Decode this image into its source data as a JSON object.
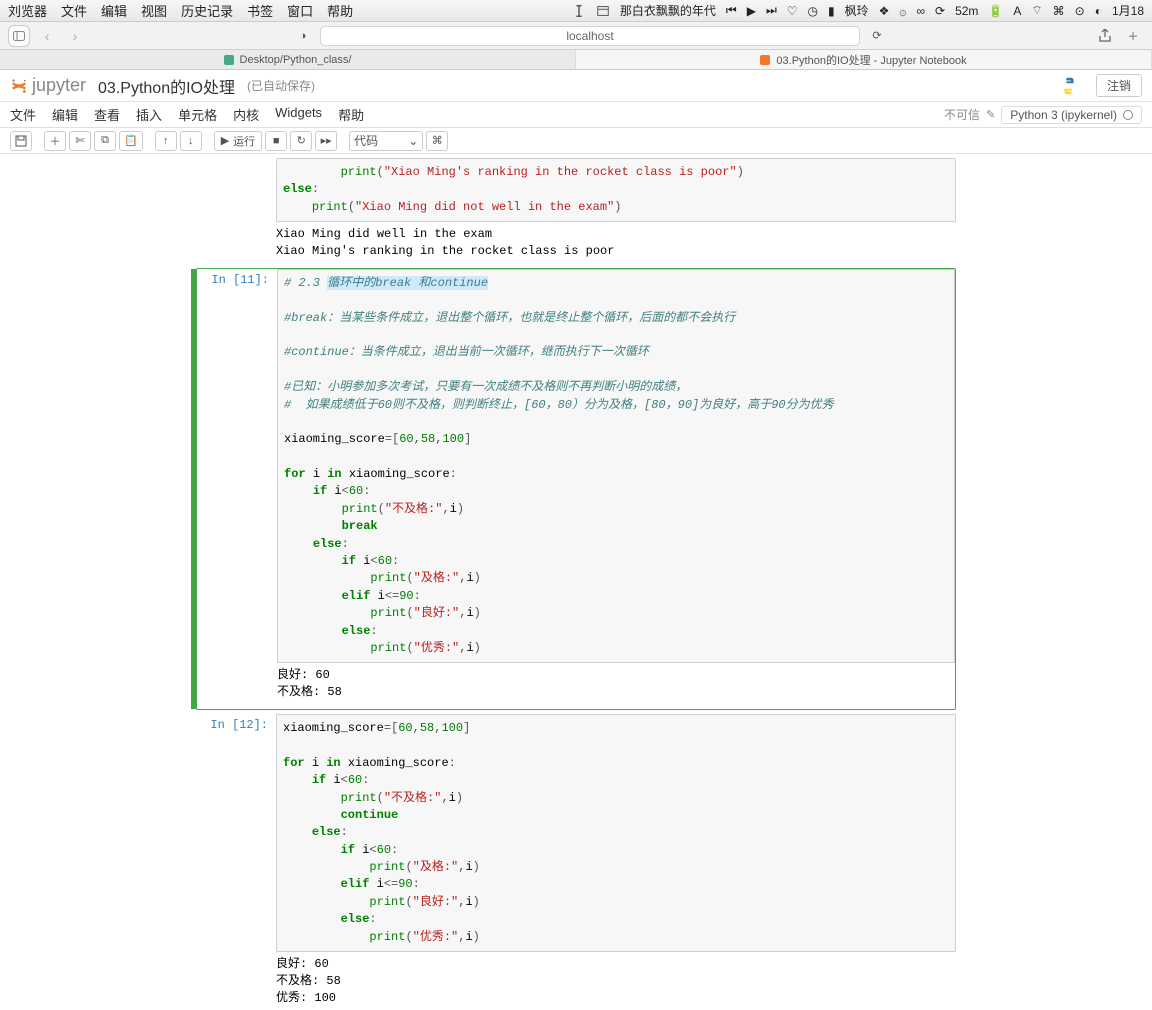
{
  "mac_menu": {
    "app": "刘览器",
    "items": [
      "文件",
      "编辑",
      "视图",
      "历史记录",
      "书签",
      "窗口",
      "帮助"
    ],
    "right": {
      "song": "那白衣飘飘的年代",
      "user": "枫玲",
      "time": "52m",
      "date": "1月18"
    }
  },
  "browser": {
    "url": "localhost",
    "tabs": [
      {
        "label": "Desktop/Python_class/",
        "active": false
      },
      {
        "label": "03.Python的IO处理 - Jupyter Notebook",
        "active": true
      }
    ]
  },
  "notebook": {
    "logo_word": "jupyter",
    "name": "03.Python的IO处理",
    "autosave": "(已自动保存)",
    "logout": "注销",
    "menus": [
      "文件",
      "编辑",
      "查看",
      "插入",
      "单元格",
      "内核",
      "Widgets",
      "帮助"
    ],
    "trusted": "不可信",
    "kernel": "Python 3 (ipykernel)",
    "toolbar": {
      "run_label": "运行",
      "celltype": "代码"
    }
  },
  "cells": {
    "top_output": "Xiao Ming did well in the exam\nXiao Ming's ranking in the rocket class is poor",
    "cell11": {
      "prompt": "In [11]:",
      "comment_title": "# 2.3 ",
      "comment_title_hl": "循环中的break 和continue",
      "break_comment": "#break：当某些条件成立，退出整个循环，也就是终止整个循环，后面的都不会执行",
      "continue_comment": "#continue：当条件成立，退出当前一次循环，继而执行下一次循环",
      "known1": "#已知：小明参加多次考试，只要有一次成绩不及格则不再判断小明的成绩，",
      "known2": "#  如果成绩低于60则不及格，则判断终止，[60，80）分为及格，[80，90]为良好，高于90分为优秀",
      "output": "良好: 60\n不及格: 58"
    },
    "cell12": {
      "prompt": "In [12]:",
      "output": "良好: 60\n不及格: 58\n优秀: 100"
    },
    "code_strings": {
      "assign_pre": "xiaoming_score=[",
      "n60": "60",
      "n58": "58",
      "n100": "100",
      "for_kw": "for",
      "in_kw": "in",
      "var_i": "i",
      "var_list": "xiaoming_score",
      "if_kw": "if",
      "lt60": "60",
      "else_kw": "else",
      "elif_kw": "elif",
      "le90": "90",
      "print": "print",
      "break_kw": "break",
      "continue_kw": "continue",
      "s_fail": "\"不及格:\"",
      "s_pass": "\"及格:\"",
      "s_good": "\"良好:\"",
      "s_exc": "\"优秀:\"",
      "top_print1_pre": "print(",
      "top_print1_str": "\"Xiao Ming's ranking in the rocket class is poor\"",
      "top_print1_post": ")",
      "top_else": "else",
      "top_print2_str": "\"Xiao Ming did not well in the exam\""
    }
  }
}
